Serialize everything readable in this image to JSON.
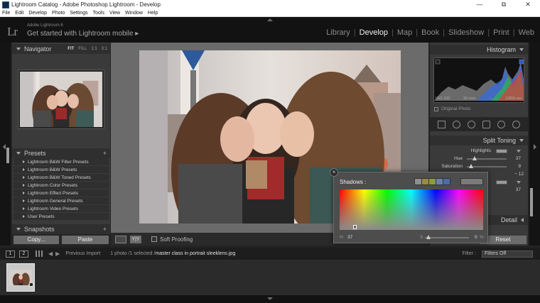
{
  "window": {
    "title": "Lightroom Catalog - Adobe Photoshop Lightroom - Develop",
    "controls": [
      "minimize-icon",
      "restore-icon",
      "close-icon"
    ]
  },
  "menu": [
    "File",
    "Edit",
    "Develop",
    "Photo",
    "Settings",
    "Tools",
    "View",
    "Window",
    "Help"
  ],
  "identity": {
    "logo": "Lr",
    "version": "Adobe Lightroom 6",
    "mobile": "Get started with Lightroom mobile ▸"
  },
  "modules": {
    "items": [
      "Library",
      "Develop",
      "Map",
      "Book",
      "Slideshow",
      "Print",
      "Web"
    ],
    "active": "Develop"
  },
  "left_panel": {
    "navigator": {
      "title": "Navigator",
      "fit": "FIT",
      "fill": "FILL",
      "one": "1:1",
      "three": "3:1"
    },
    "presets": {
      "title": "Presets",
      "items": [
        "Lightroom B&W Filter Presets",
        "Lightroom B&W Presets",
        "Lightroom B&W Toned Presets",
        "Lightroom Color Presets",
        "Lightroom Effect Presets",
        "Lightroom General Presets",
        "Lightroom Video Presets",
        "User Presets"
      ]
    },
    "snapshots": {
      "title": "Snapshots"
    },
    "copy_label": "Copy...",
    "paste_label": "Paste"
  },
  "toolbar": {
    "soft_proofing": "Soft Proofing",
    "view_mode": "Y|Y"
  },
  "right_panel": {
    "histogram": {
      "title": "Histogram",
      "iso": "ISO 100",
      "focal": "50 mm",
      "aperture": "--",
      "shutter": "1/800 sec",
      "original_photo": "Original Photo"
    },
    "split_toning": {
      "title": "Split Toning",
      "highlights_label": "Highlights",
      "hue_label": "Hue",
      "hue_value": "37",
      "saturation_label": "Saturation",
      "saturation_value": "9",
      "balance_value": "− 12",
      "shadow_hue_value": "37",
      "shadow_sat_value": "0"
    },
    "detail": {
      "title": "Detail"
    },
    "reset_label": "Reset"
  },
  "color_picker": {
    "title": "Shadows :",
    "swatch_colors": [
      "#8f8f8f",
      "#9b8a3f",
      "#8c9a44",
      "#6c7fb0",
      "#4e6ba6"
    ],
    "hue_label": "H",
    "hue_value": "37",
    "sat_label": "S",
    "sat_value": "0",
    "percent": "%",
    "close": "×"
  },
  "filmstrip": {
    "view1": "1",
    "view2": "2",
    "source": "Previous Import",
    "selection": "1 photo /1 selected /",
    "filename": "master class in portrait sleeklens.jpg",
    "filter_label": "Filter :",
    "filter_value": "Filters Off"
  },
  "colors": {
    "accent_active_module": "#f0f0f0",
    "panel_bg": "#3a3a3a",
    "canvas_bg": "#6b6b6b"
  }
}
